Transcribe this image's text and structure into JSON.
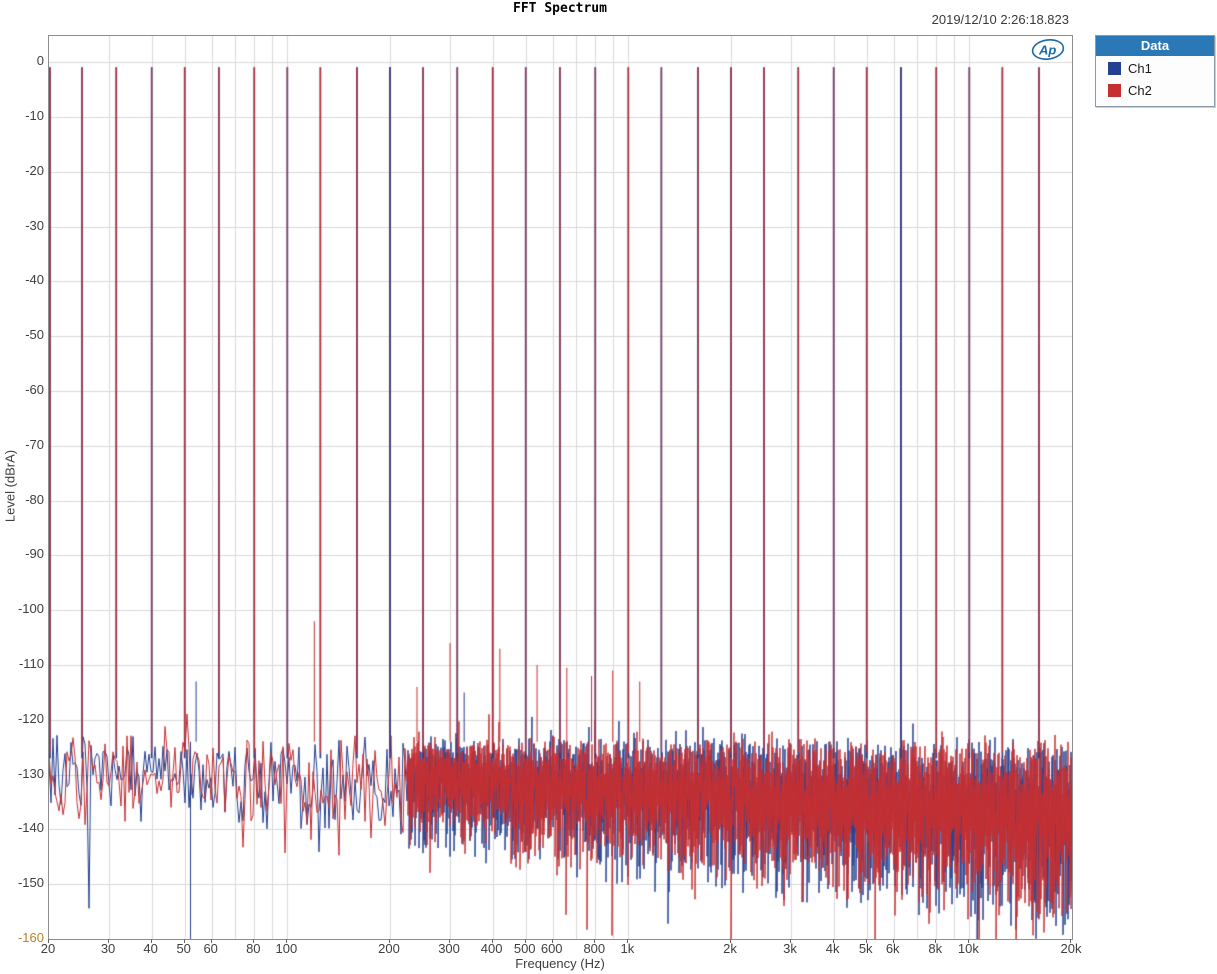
{
  "header": {
    "title": "FFT Spectrum",
    "timestamp": "2019/12/10 2:26:18.823"
  },
  "logo": {
    "text": "Ap",
    "color": "#1a6aab"
  },
  "legend": {
    "header": "Data",
    "header_bg": "#2a78b6",
    "items": [
      {
        "label": "Ch1",
        "color": "#24418f"
      },
      {
        "label": "Ch2",
        "color": "#c42f32"
      }
    ]
  },
  "chart_data": {
    "type": "line",
    "title": "FFT Spectrum",
    "xlabel": "Frequency (Hz)",
    "ylabel": "Level (dBrA)",
    "xscale": "log",
    "xlim": [
      20,
      20000
    ],
    "ylim": [
      -160,
      4.8
    ],
    "grid": true,
    "legend_position": "top-right",
    "y_ticks": [
      {
        "db": 0,
        "label": "0"
      },
      {
        "db": -10,
        "label": "-10"
      },
      {
        "db": -20,
        "label": "-20"
      },
      {
        "db": -30,
        "label": "-30"
      },
      {
        "db": -40,
        "label": "-40"
      },
      {
        "db": -50,
        "label": "-50"
      },
      {
        "db": -60,
        "label": "-60"
      },
      {
        "db": -70,
        "label": "-70"
      },
      {
        "db": -80,
        "label": "-80"
      },
      {
        "db": -90,
        "label": "-90"
      },
      {
        "db": -100,
        "label": "-100"
      },
      {
        "db": -110,
        "label": "-110"
      },
      {
        "db": -120,
        "label": "-120"
      },
      {
        "db": -130,
        "label": "-130"
      },
      {
        "db": -140,
        "label": "-140"
      },
      {
        "db": -150,
        "label": "-150"
      },
      {
        "db": -160,
        "label": "-160",
        "highlight": true
      }
    ],
    "x_ticks": [
      {
        "f": 20,
        "label": "20"
      },
      {
        "f": 30,
        "label": "30"
      },
      {
        "f": 40,
        "label": "40"
      },
      {
        "f": 50,
        "label": "50"
      },
      {
        "f": 60,
        "label": "60"
      },
      {
        "f": 80,
        "label": "80"
      },
      {
        "f": 100,
        "label": "100"
      },
      {
        "f": 200,
        "label": "200"
      },
      {
        "f": 300,
        "label": "300"
      },
      {
        "f": 400,
        "label": "400"
      },
      {
        "f": 500,
        "label": "500"
      },
      {
        "f": 600,
        "label": "600"
      },
      {
        "f": 800,
        "label": "800"
      },
      {
        "f": 1000,
        "label": "1k"
      },
      {
        "f": 2000,
        "label": "2k"
      },
      {
        "f": 3000,
        "label": "3k"
      },
      {
        "f": 4000,
        "label": "4k"
      },
      {
        "f": 5000,
        "label": "5k"
      },
      {
        "f": 6000,
        "label": "6k"
      },
      {
        "f": 8000,
        "label": "8k"
      },
      {
        "f": 10000,
        "label": "10k"
      },
      {
        "f": 20000,
        "label": "20k"
      }
    ],
    "series": [
      {
        "name": "Ch1",
        "color": "#24418f"
      },
      {
        "name": "Ch2",
        "color": "#c42f32"
      }
    ],
    "multitone": {
      "level_db": -0.9,
      "frequencies_hz": [
        20,
        25,
        31.5,
        40,
        50,
        63,
        80,
        100,
        125,
        160,
        200,
        250,
        315,
        400,
        500,
        630,
        800,
        1000,
        1250,
        1600,
        2000,
        2500,
        3150,
        4000,
        5000,
        6300,
        8000,
        10000,
        12500,
        16000
      ],
      "ch1_visible_on_top_hz": [
        200,
        6300
      ]
    },
    "spurs": [
      {
        "channel": "Ch2",
        "f": 120,
        "db": -102
      },
      {
        "channel": "Ch2",
        "f": 240,
        "db": -114
      },
      {
        "channel": "Ch2",
        "f": 300,
        "db": -106
      },
      {
        "channel": "Ch2",
        "f": 420,
        "db": -107
      },
      {
        "channel": "Ch2",
        "f": 540,
        "db": -110
      },
      {
        "channel": "Ch2",
        "f": 660,
        "db": -110.5
      },
      {
        "channel": "Ch2",
        "f": 780,
        "db": -112
      },
      {
        "channel": "Ch2",
        "f": 900,
        "db": -111
      },
      {
        "channel": "Ch2",
        "f": 1080,
        "db": -113
      },
      {
        "channel": "Ch1",
        "f": 54,
        "db": -113
      },
      {
        "channel": "Ch1",
        "f": 330,
        "db": -115
      }
    ],
    "deep_nulls": [
      {
        "channel": "Ch1",
        "f": 52,
        "db": -160
      }
    ],
    "noise_floor": {
      "top_db": -121.5,
      "span_db_at_20hz": 16,
      "span_db_at_20khz": 36,
      "note": "dense random noise floor; spread widens toward high frequencies"
    }
  }
}
